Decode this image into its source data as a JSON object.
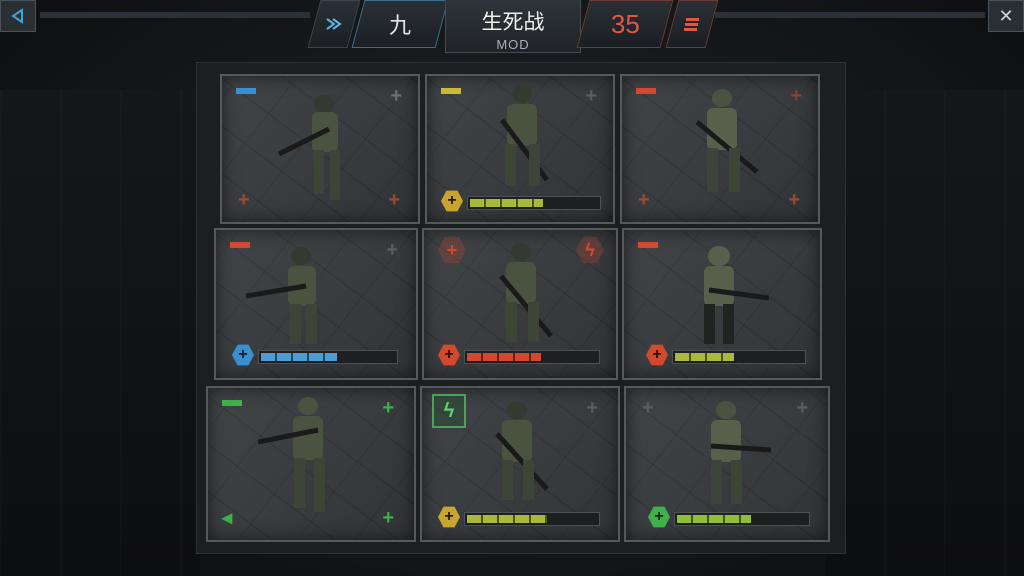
{
  "header": {
    "title": "生死战",
    "subtitle": "MOD",
    "level_label": "九",
    "count": "35"
  },
  "colors": {
    "blue": "#3a8fd1",
    "orange": "#d2492f",
    "yellow": "#c9b93a",
    "green": "#3fb04a"
  },
  "cards": [
    {
      "stripe": "blue",
      "hp": null,
      "badge": null
    },
    {
      "stripe": "yellow",
      "hp": 0.55,
      "badge": "plus-yellow"
    },
    {
      "stripe": "orange",
      "hp": null,
      "badge": null
    },
    {
      "stripe": "orange",
      "hp": 0.55,
      "badge": "plus-blue"
    },
    {
      "stripe": "none",
      "hp": 0.55,
      "badge": "plus-orange"
    },
    {
      "stripe": "orange",
      "hp": 0.45,
      "badge": "plus-orange"
    },
    {
      "stripe": "green",
      "hp": null,
      "badge": null
    },
    {
      "stripe": "none",
      "hp": 0.6,
      "badge": "plus-yellow"
    },
    {
      "stripe": "none",
      "hp": 0.55,
      "badge": "plus-green"
    }
  ]
}
